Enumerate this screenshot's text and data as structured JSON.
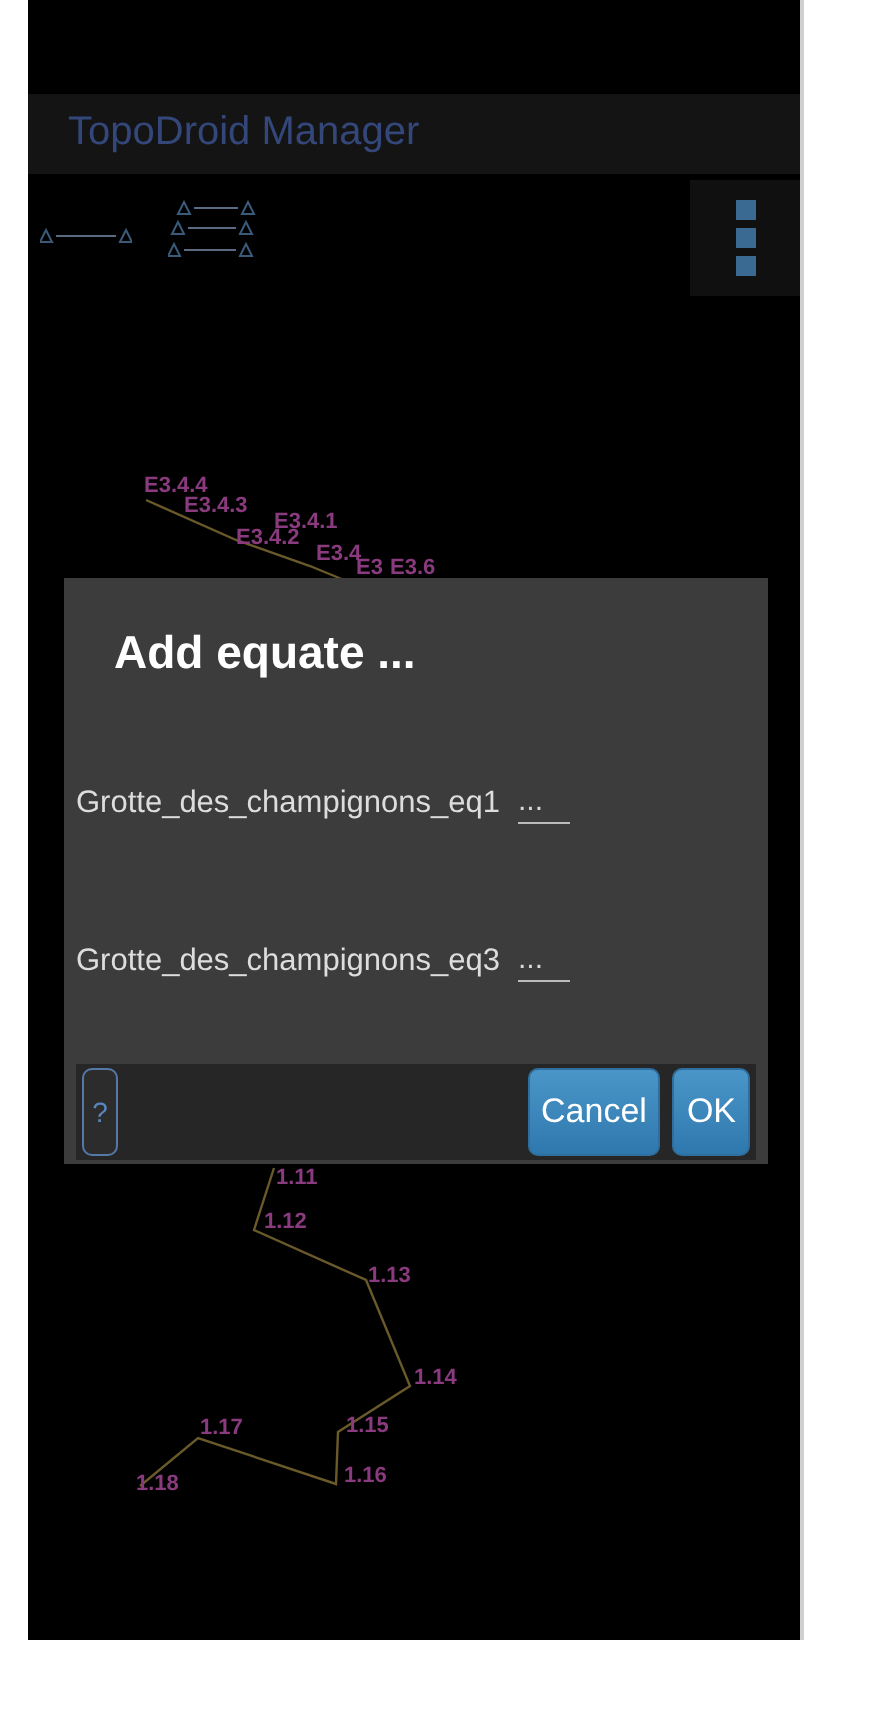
{
  "app_bar": {
    "title": "TopoDroid Manager"
  },
  "toolbar": {
    "buttons": [
      {
        "kind": "single-link"
      },
      {
        "kind": "multi-link"
      }
    ],
    "menu": {
      "kind": "overflow"
    }
  },
  "map": {
    "stations": [
      {
        "label": "E3.4.4"
      },
      {
        "label": "E3.4.3"
      },
      {
        "label": "E3.4.1"
      },
      {
        "label": "E3.4.2"
      },
      {
        "label": "E3.4"
      },
      {
        "label": "E3"
      },
      {
        "label": "E3.6"
      },
      {
        "label": "1.11"
      },
      {
        "label": "1.12"
      },
      {
        "label": "1.13"
      },
      {
        "label": "1.14"
      },
      {
        "label": "1.15"
      },
      {
        "label": "1.16"
      },
      {
        "label": "1.17"
      },
      {
        "label": "1.18"
      }
    ]
  },
  "dialog": {
    "title": "Add equate ...",
    "rows": [
      {
        "label": "Grotte_des_champignons_eq1",
        "placeholder": "..."
      },
      {
        "label": "Grotte_des_champignons_eq3",
        "placeholder": "..."
      }
    ],
    "buttons": [
      {
        "label": "?",
        "kind": "help"
      },
      {
        "label": "Cancel",
        "kind": "action"
      },
      {
        "label": "OK",
        "kind": "action"
      }
    ]
  }
}
